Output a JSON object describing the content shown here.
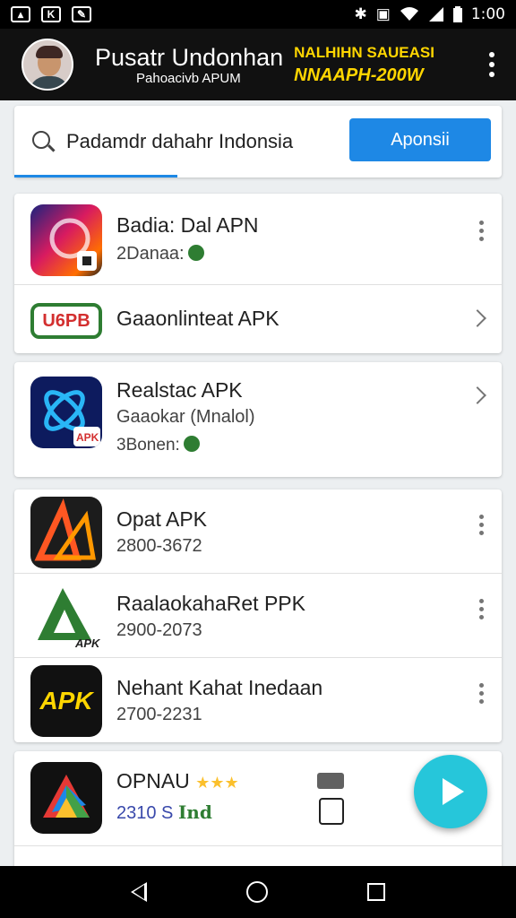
{
  "status_bar": {
    "time": "1:00",
    "left_icons": [
      "image-icon",
      "k-icon",
      "edit-icon"
    ],
    "right_icons": [
      "bluetooth-icon",
      "vibrate-icon",
      "wifi-icon",
      "signal-icon",
      "battery-icon"
    ]
  },
  "header": {
    "title": "Pusatr Undonhan",
    "subtitle": "Pahoacivb APUM",
    "promo_line1": "NALHIHN SAUEASI",
    "promo_line2": "NNAAPH-200W"
  },
  "search": {
    "value": "Padamdr dahahr Indonsia",
    "button_label": "Aponsii"
  },
  "apps": [
    {
      "name": "Badia: Dal APN",
      "sub": "2Danaa:"
    },
    {
      "name": "Gaaonlinteat APK",
      "logo_text": "U6PB"
    },
    {
      "name": "Realstac APK",
      "sub": "Gaaokar (Mnalol)",
      "sub2": "3Bonen:",
      "badge": "APK"
    },
    {
      "name": "Opat APK",
      "sub": "2800-3672"
    },
    {
      "name": "RaalaokahaRet PPK",
      "sub": "2900-2073",
      "badge": "APK"
    },
    {
      "name": "Nehant Kahat Inedaan",
      "sub": "2700-2231",
      "logo_text": "APK"
    },
    {
      "name": "OPNAU",
      "stars": "★★★",
      "sub": "2310 S",
      "sub_green": "Ind"
    }
  ],
  "colors": {
    "accent": "#1e88e5",
    "fab": "#26c6da",
    "promo": "#ffd600",
    "rating": "#fbc02d",
    "download": "#2e7d32"
  }
}
